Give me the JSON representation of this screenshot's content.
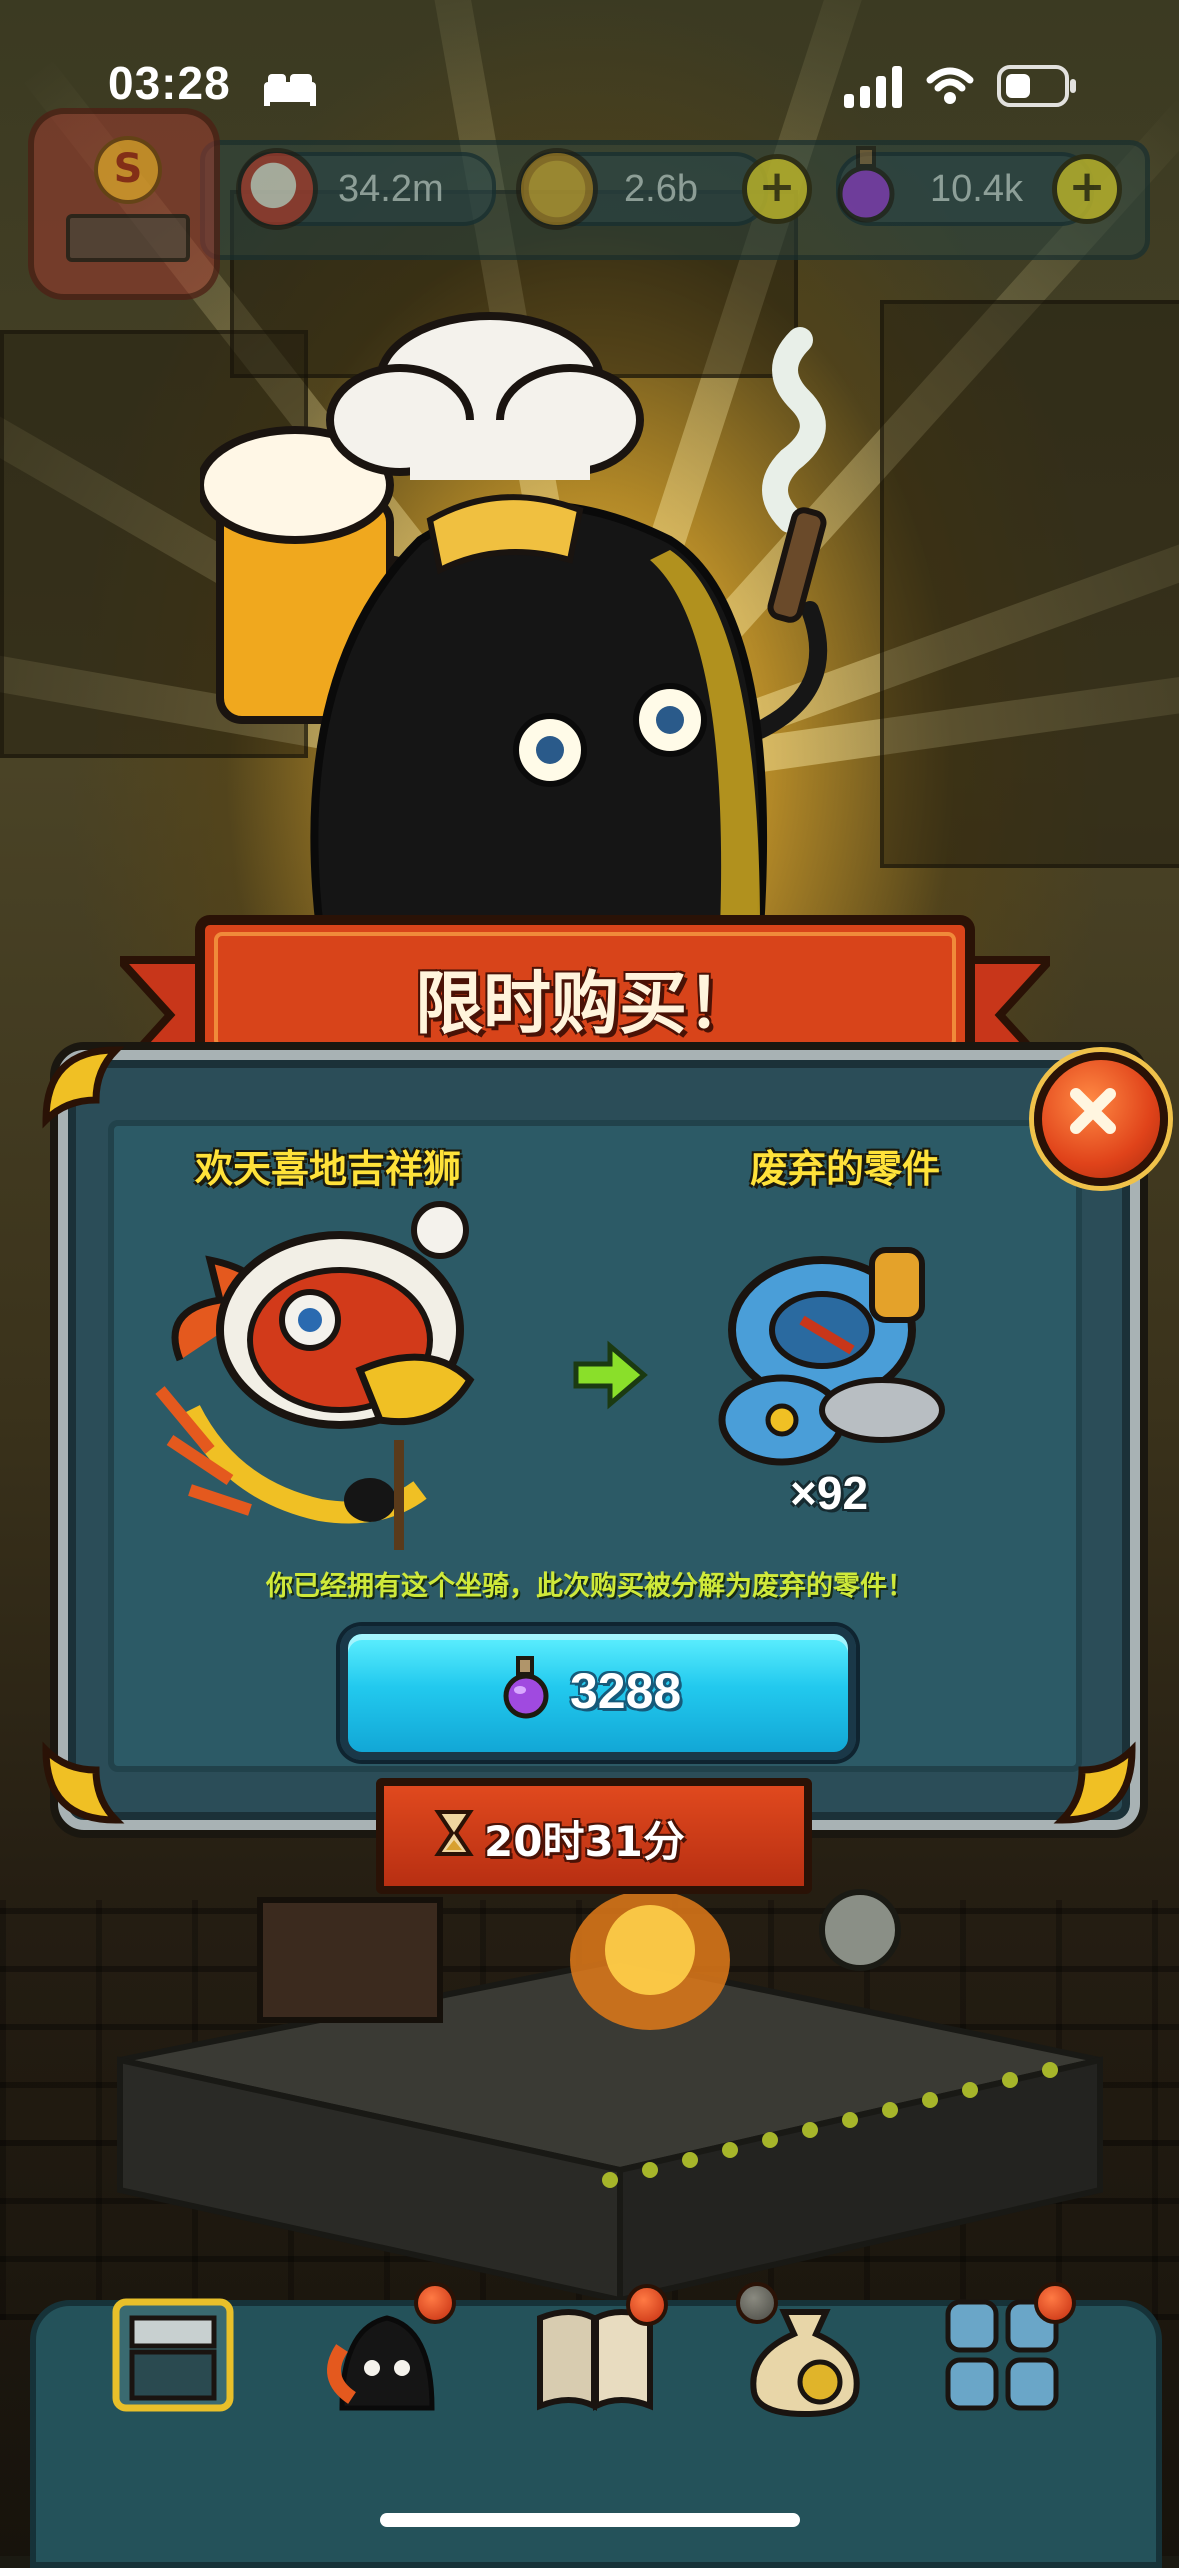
{
  "status_bar": {
    "time": "03:28"
  },
  "resources": {
    "eyes": {
      "value": "34.2m",
      "icon": "eyeball-icon"
    },
    "coins": {
      "value": "2.6b",
      "icon": "coin-icon"
    },
    "potions": {
      "value": "10.4k",
      "icon": "potion-icon"
    }
  },
  "level_badge": {
    "letter": "S"
  },
  "dialog": {
    "title": "限时购买！",
    "left_item": {
      "name": "欢天喜地吉祥狮",
      "icon": "lion-dance-mount-icon"
    },
    "right_item": {
      "name": "废弃的零件",
      "quantity": "×92",
      "icon": "scrap-parts-icon"
    },
    "notice": "你已经拥有这个坐骑，此次购买被分解为废弃的零件！",
    "buy_button": {
      "price": "3288",
      "currency_icon": "potion-icon"
    },
    "timer": "20时31分",
    "close_icon": "close-icon"
  },
  "bottom_nav": {
    "items": [
      {
        "icon": "shop-building-icon"
      },
      {
        "icon": "character-icon"
      },
      {
        "icon": "book-icon"
      },
      {
        "icon": "money-bag-icon"
      },
      {
        "icon": "grid-menu-icon"
      }
    ]
  },
  "colors": {
    "accent_red": "#d8441a",
    "accent_cyan": "#22c9ee",
    "text_yellow": "#ffe23a",
    "panel_teal": "#2c5a66"
  }
}
